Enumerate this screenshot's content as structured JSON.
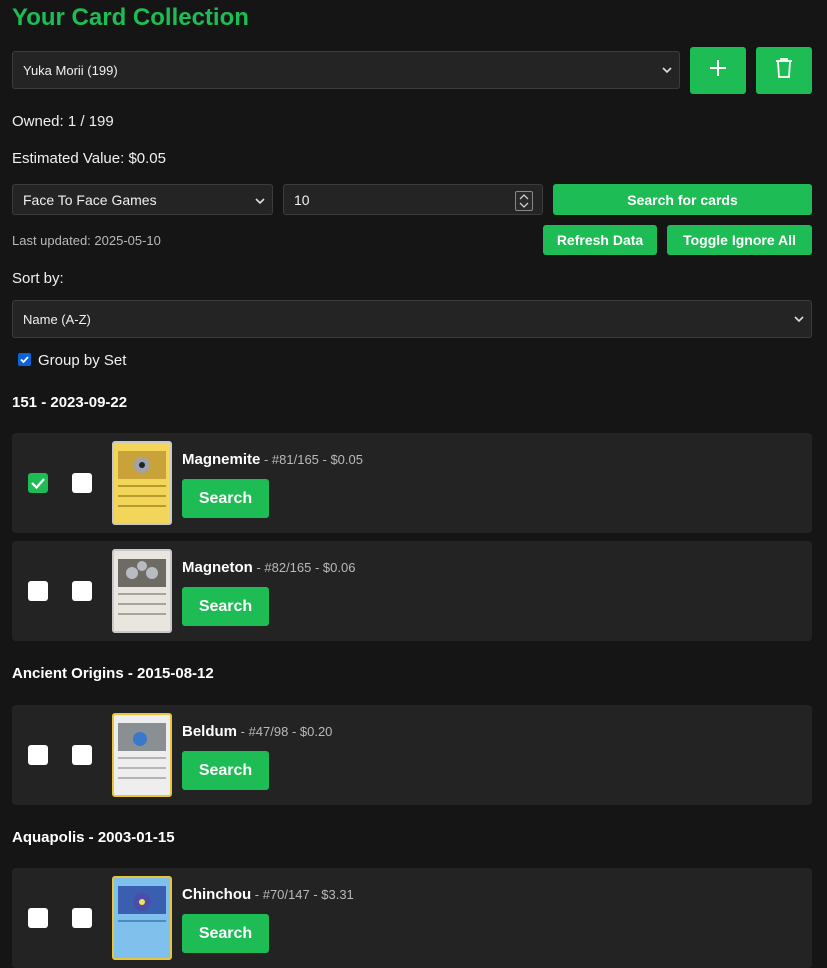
{
  "header": {
    "title": "Your Card Collection"
  },
  "collection": {
    "selected": "Yuka Morii (199)"
  },
  "stats": {
    "owned": "Owned: 1 / 199",
    "value": "Estimated Value: $0.05"
  },
  "store": {
    "selected": "Face To Face Games",
    "quantity": "10",
    "search_label": "Search for cards"
  },
  "updated": {
    "text": "Last updated: 2025-05-10",
    "refresh_label": "Refresh Data",
    "toggle_label": "Toggle Ignore All"
  },
  "sort": {
    "label": "Sort by:",
    "selected": "Name (A-Z)"
  },
  "group": {
    "label": "Group by Set",
    "checked": true
  },
  "sets": [
    {
      "title": "151 - 2023-09-22",
      "cards": [
        {
          "name": "Magnemite",
          "meta": " - #81/165 - $0.05",
          "owned": true,
          "ignored": false,
          "search_label": "Search"
        },
        {
          "name": "Magneton",
          "meta": " - #82/165 - $0.06",
          "owned": false,
          "ignored": false,
          "search_label": "Search"
        }
      ]
    },
    {
      "title": "Ancient Origins - 2015-08-12",
      "cards": [
        {
          "name": "Beldum",
          "meta": " - #47/98 - $0.20",
          "owned": false,
          "ignored": false,
          "search_label": "Search"
        }
      ]
    },
    {
      "title": "Aquapolis - 2003-01-15",
      "cards": [
        {
          "name": "Chinchou",
          "meta": " - #70/147 - $3.31",
          "owned": false,
          "ignored": false,
          "search_label": "Search"
        }
      ]
    }
  ],
  "icons": {
    "add": "plus-icon",
    "delete": "trash-icon",
    "owned": "checkmark-icon"
  },
  "colors": {
    "accent": "#1dbc55",
    "background": "#151515",
    "panel": "#232323"
  }
}
